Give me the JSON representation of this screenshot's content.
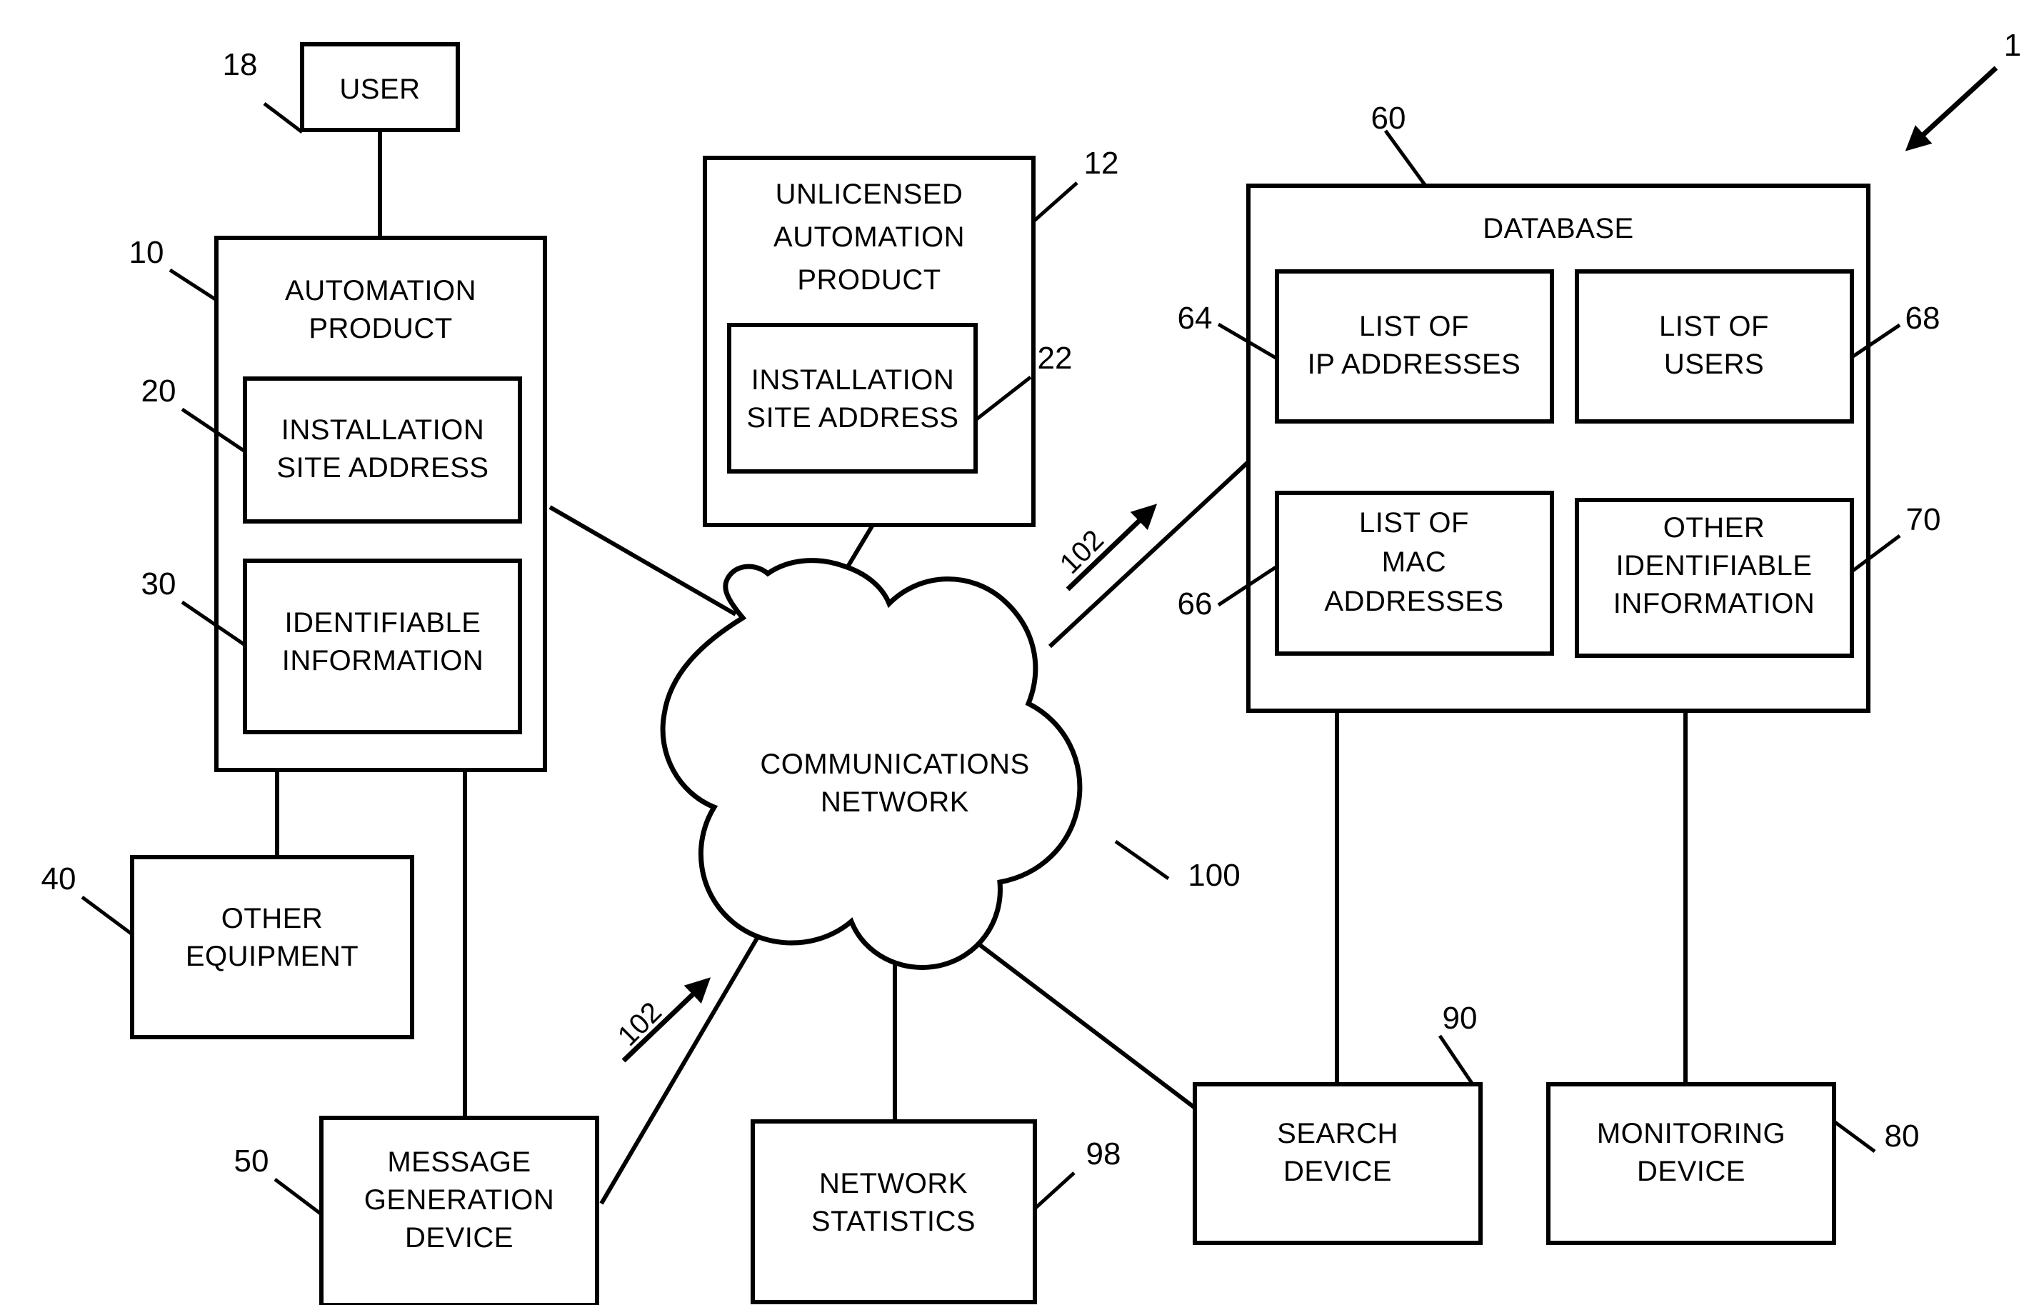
{
  "figure": {
    "figure_ref": "1",
    "nodes": {
      "user": {
        "label": "USER",
        "ref": "18"
      },
      "automation_product": {
        "label_line1": "AUTOMATION",
        "label_line2": "PRODUCT",
        "ref": "10",
        "children": {
          "installation_site_address": {
            "label_line1": "INSTALLATION",
            "label_line2": "SITE ADDRESS",
            "ref": "20"
          },
          "identifiable_information": {
            "label_line1": "IDENTIFIABLE",
            "label_line2": "INFORMATION",
            "ref": "30"
          }
        }
      },
      "unlicensed_automation_product": {
        "label_line1": "UNLICENSED",
        "label_line2": "AUTOMATION",
        "label_line3": "PRODUCT",
        "ref": "12",
        "children": {
          "installation_site_address": {
            "label_line1": "INSTALLATION",
            "label_line2": "SITE ADDRESS",
            "ref": "22"
          }
        }
      },
      "other_equipment": {
        "label_line1": "OTHER",
        "label_line2": "EQUIPMENT",
        "ref": "40"
      },
      "message_generation_device": {
        "label_line1": "MESSAGE",
        "label_line2": "GENERATION",
        "label_line3": "DEVICE",
        "ref": "50"
      },
      "communications_network": {
        "label_line1": "COMMUNICATIONS",
        "label_line2": "NETWORK",
        "ref": "100"
      },
      "network_statistics": {
        "label_line1": "NETWORK",
        "label_line2": "STATISTICS",
        "ref": "98"
      },
      "database": {
        "label": "DATABASE",
        "ref": "60",
        "children": {
          "list_of_ip_addresses": {
            "label_line1": "LIST OF",
            "label_line2": "IP ADDRESSES",
            "ref": "64"
          },
          "list_of_users": {
            "label_line1": "LIST OF",
            "label_line2": "USERS",
            "ref": "68"
          },
          "list_of_mac_addresses": {
            "label_line1": "LIST OF",
            "label_line2": "MAC",
            "label_line3": "ADDRESSES",
            "ref": "66"
          },
          "other_identifiable_information": {
            "label_line1": "OTHER",
            "label_line2": "IDENTIFIABLE",
            "label_line3": "INFORMATION",
            "ref": "70"
          }
        }
      },
      "search_device": {
        "label_line1": "SEARCH",
        "label_line2": "DEVICE",
        "ref": "90"
      },
      "monitoring_device": {
        "label_line1": "MONITORING",
        "label_line2": "DEVICE",
        "ref": "80"
      }
    },
    "flows": {
      "message_to_network": {
        "ref": "102"
      },
      "network_to_database": {
        "ref": "102"
      }
    }
  }
}
